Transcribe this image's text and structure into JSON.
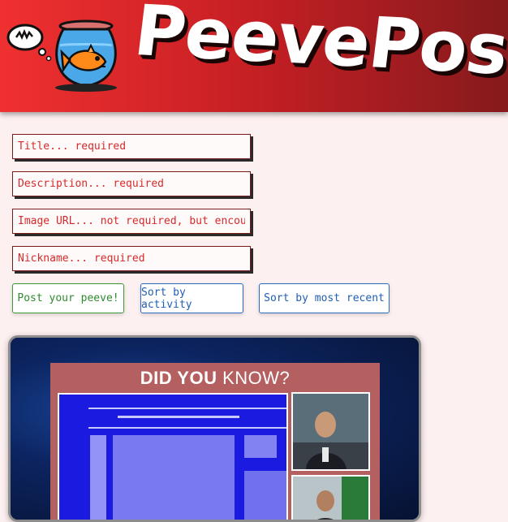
{
  "header": {
    "brand": "PeevePost",
    "logo_icon": "fishbowl-icon",
    "thought_icon": "thought-bubble-icon",
    "colors": {
      "gradient_start": "#f03030",
      "gradient_end": "#861a1c"
    }
  },
  "form": {
    "title_placeholder": "Title... required",
    "description_placeholder": "Description... required",
    "image_url_placeholder": "Image URL... not required, but encouraged",
    "nickname_placeholder": "Nickname... required"
  },
  "buttons": {
    "post": "Post your peeve!",
    "sort_activity": "Sort by activity",
    "sort_recent": "Sort by most recent"
  },
  "post": {
    "image": {
      "headline_part1": "DID YOU",
      "headline_part2": "KNOW?"
    }
  },
  "colors": {
    "page_bg": "#fdf0f0",
    "placeholder_red": "#d62a2a",
    "post_green": "#2e8b2e",
    "sort_blue": "#1f5fb5"
  }
}
